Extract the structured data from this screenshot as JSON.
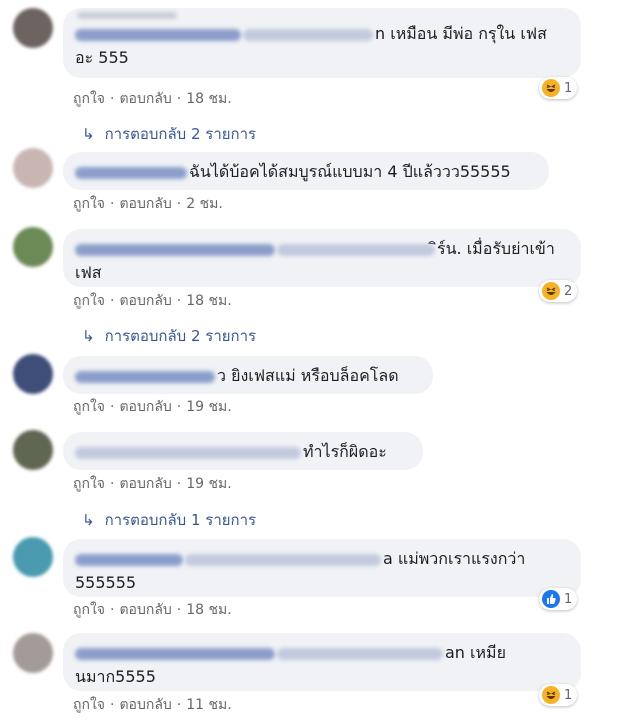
{
  "ui": {
    "like_label": "ถูกใจ",
    "reply_label": "ตอบกลับ",
    "separator": "·",
    "reply_arrow": "↳",
    "colors": {
      "bubble_bg": "#f0f2f5",
      "link": "#385898",
      "meta": "#65676b",
      "haha": "#f7b125",
      "like": "#1877f2"
    }
  },
  "comments": [
    {
      "text_line1": "n เหมือน มีพ่อ กรุใน เฟส",
      "text_line2": "อะ 555",
      "time": "18 ชม.",
      "reaction_icon": "haha-emoji-icon",
      "reaction_count": "1",
      "replies": "การตอบกลับ 2 รายการ"
    },
    {
      "text_line1": "ฉันได้บ้อคได้สมบูรณ์แบบมา 4 ปีแล้ววว55555",
      "time": "2 ชม."
    },
    {
      "text_line1": "ิร์น. เมื่อรับย่าเข้า",
      "text_line2": "เฟส",
      "time": "18 ชม.",
      "reaction_icon": "haha-emoji-icon",
      "reaction_count": "2",
      "replies": "การตอบกลับ 2 รายการ"
    },
    {
      "text_line1": "ว ยิงเฟสแม่ หรือบล็อคโลด",
      "time": "19 ชม."
    },
    {
      "text_line1": "ทำไรก็ผิดอะ",
      "time": "19 ชม.",
      "replies": "การตอบกลับ 1 รายการ"
    },
    {
      "text_line1": "a แม่พวกเราแรงกว่า",
      "text_line2": "555555",
      "time": "18 ชม.",
      "reaction_icon": "like-thumb-icon",
      "reaction_count": "1"
    },
    {
      "text_line1": "an เหมีย",
      "text_line2": "นมาก5555",
      "time": "11 ชม.",
      "reaction_icon": "haha-emoji-icon",
      "reaction_count": "1"
    }
  ]
}
